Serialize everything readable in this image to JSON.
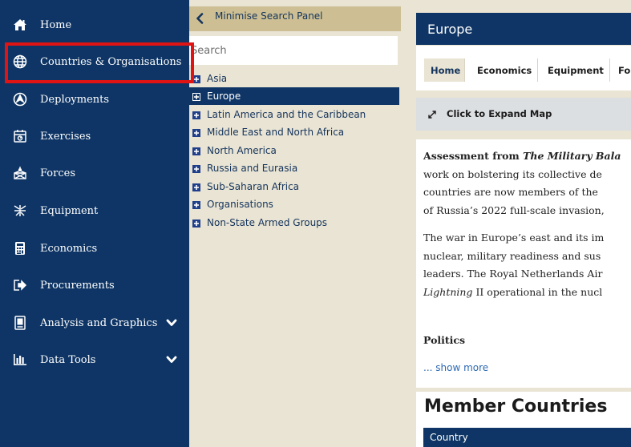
{
  "sidebar": {
    "items": [
      {
        "label": "Home",
        "icon": "home-icon"
      },
      {
        "label": "Countries & Organisations",
        "icon": "globe-icon"
      },
      {
        "label": "Deployments",
        "icon": "deployment-icon"
      },
      {
        "label": "Exercises",
        "icon": "exercise-icon"
      },
      {
        "label": "Forces",
        "icon": "forces-icon"
      },
      {
        "label": "Equipment",
        "icon": "equipment-icon"
      },
      {
        "label": "Economics",
        "icon": "calculator-icon"
      },
      {
        "label": "Procurements",
        "icon": "procurement-icon"
      },
      {
        "label": "Analysis and Graphics",
        "icon": "analysis-icon"
      },
      {
        "label": "Data Tools",
        "icon": "bar-chart-icon"
      }
    ]
  },
  "search_panel": {
    "minimise_label": "Minimise Search Panel",
    "search_placeholder": "Search",
    "tree": [
      {
        "label": "Asia",
        "selected": false
      },
      {
        "label": "Europe",
        "selected": true
      },
      {
        "label": "Latin America and the Caribbean",
        "selected": false
      },
      {
        "label": "Middle East and North Africa",
        "selected": false
      },
      {
        "label": "North America",
        "selected": false
      },
      {
        "label": "Russia and Eurasia",
        "selected": false
      },
      {
        "label": "Sub-Saharan Africa",
        "selected": false
      },
      {
        "label": "Organisations",
        "selected": false
      },
      {
        "label": "Non-State Armed Groups",
        "selected": false
      }
    ]
  },
  "main": {
    "title": "Europe",
    "tabs": [
      "Home",
      "Economics",
      "Equipment",
      "Fo"
    ],
    "active_tab": "Home",
    "expand_map_label": "Click to Expand Map",
    "assessment": {
      "heading_prefix": "Assessment from ",
      "heading_title": "The Military Bala",
      "lines_1": [
        "work on bolstering its collective de",
        "countries are now members of the ",
        "of Russia’s 2022 full-scale invasion,"
      ],
      "lines_2": [
        "The war in Europe’s east and its im",
        "nuclear, military readiness and sus",
        "leaders. The Royal Netherlands Air"
      ],
      "line_2_last_italic": "Lightning",
      "line_2_last_rest": " II operational in the nucl",
      "politics_label": "Politics",
      "show_more_label": "... show more"
    },
    "members": {
      "title": "Member Countries",
      "country_header": "Country"
    }
  },
  "colors": {
    "navy": "#0e3565",
    "panel_beige": "#e9e4d3",
    "minimise_tan": "#cdbf93",
    "highlight_red": "#e11414",
    "link_blue": "#2e6ab3"
  }
}
